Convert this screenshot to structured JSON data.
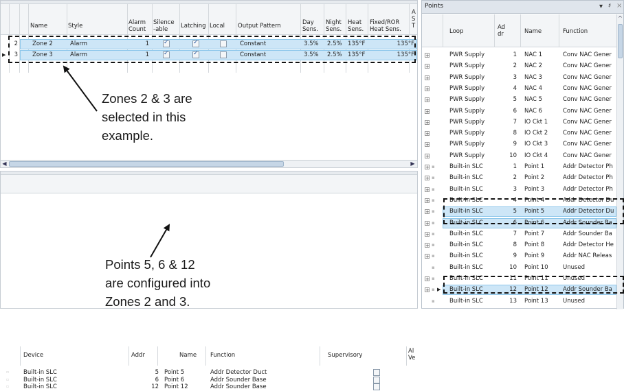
{
  "zones_table": {
    "headers": [
      [
        "Name"
      ],
      [
        "Style"
      ],
      [
        "Alarm",
        "Count"
      ],
      [
        "Silence",
        "-able"
      ],
      [
        "Latching"
      ],
      [
        "Local"
      ],
      [
        "Output Pattern"
      ],
      [
        "Day",
        "Sens."
      ],
      [
        "Night",
        "Sens."
      ],
      [
        "Heat",
        "Sens."
      ],
      [
        "Fixed/ROR",
        "Heat Sens."
      ],
      [
        "A",
        "S",
        "T"
      ]
    ],
    "rows": [
      {
        "num": "2",
        "name": "Zone 2",
        "style": "Alarm",
        "alarm_count": "1",
        "silenceable": true,
        "latching": true,
        "local": false,
        "output_pattern": "Constant",
        "day": "3.5%",
        "night": "2.5%",
        "heat": "135°F",
        "fixed_ror": "135°F"
      },
      {
        "num": "3",
        "name": "Zone 3",
        "style": "Alarm",
        "alarm_count": "1",
        "silenceable": true,
        "latching": true,
        "local": false,
        "output_pattern": "Constant",
        "day": "3.5%",
        "night": "2.5%",
        "heat": "135°F",
        "fixed_ror": "135°F"
      }
    ]
  },
  "zone_points_table": {
    "headers": [
      "Device",
      "Addr",
      "Name",
      "Function",
      "Supervisory",
      "Al",
      "Ve"
    ],
    "rows": [
      {
        "device": "Built-in SLC",
        "addr": "5",
        "name": "Point 5",
        "function": "Addr Detector Duct",
        "supervisory": false
      },
      {
        "device": "Built-in SLC",
        "addr": "6",
        "name": "Point 6",
        "function": "Addr Sounder Base",
        "supervisory": false
      },
      {
        "device": "Built-in SLC",
        "addr": "12",
        "name": "Point 12",
        "function": "Addr Sounder Base",
        "supervisory": false
      }
    ]
  },
  "points_panel": {
    "title": "Points",
    "controls": {
      "dropdown": "▾",
      "pin": "♯",
      "close": "×"
    },
    "headers": [
      "Loop",
      "Ad",
      "dr",
      "Name",
      "Function"
    ],
    "rows": [
      {
        "loop": "PWR Supply",
        "addr": "1",
        "name": "NAC 1",
        "function": "Conv NAC Gener"
      },
      {
        "loop": "PWR Supply",
        "addr": "2",
        "name": "NAC 2",
        "function": "Conv NAC Gener"
      },
      {
        "loop": "PWR Supply",
        "addr": "3",
        "name": "NAC 3",
        "function": "Conv NAC Gener"
      },
      {
        "loop": "PWR Supply",
        "addr": "4",
        "name": "NAC 4",
        "function": "Conv NAC Gener"
      },
      {
        "loop": "PWR Supply",
        "addr": "5",
        "name": "NAC 5",
        "function": "Conv NAC Gener"
      },
      {
        "loop": "PWR Supply",
        "addr": "6",
        "name": "NAC 6",
        "function": "Conv NAC Gener"
      },
      {
        "loop": "PWR Supply",
        "addr": "7",
        "name": "IO Ckt 1",
        "function": "Conv NAC Gener"
      },
      {
        "loop": "PWR Supply",
        "addr": "8",
        "name": "IO Ckt 2",
        "function": "Conv NAC Gener"
      },
      {
        "loop": "PWR Supply",
        "addr": "9",
        "name": "IO Ckt 3",
        "function": "Conv NAC Gener"
      },
      {
        "loop": "PWR Supply",
        "addr": "10",
        "name": "IO Ckt 4",
        "function": "Conv NAC Gener"
      },
      {
        "loop": "Built-in SLC",
        "addr": "1",
        "name": "Point 1",
        "function": "Addr Detector Ph"
      },
      {
        "loop": "Built-in SLC",
        "addr": "2",
        "name": "Point 2",
        "function": "Addr Detector Ph"
      },
      {
        "loop": "Built-in SLC",
        "addr": "3",
        "name": "Point 3",
        "function": "Addr Detector Ph"
      },
      {
        "loop": "Built-in SLC",
        "addr": "4",
        "name": "Point 4",
        "function": "Addr Detector Du"
      },
      {
        "loop": "Built-in SLC",
        "addr": "5",
        "name": "Point 5",
        "function": "Addr Detector Du"
      },
      {
        "loop": "Built-in SLC",
        "addr": "6",
        "name": "Point 6",
        "function": "Addr Sounder Ba"
      },
      {
        "loop": "Built-in SLC",
        "addr": "7",
        "name": "Point 7",
        "function": "Addr Sounder Ba"
      },
      {
        "loop": "Built-in SLC",
        "addr": "8",
        "name": "Point 8",
        "function": "Addr Detector He"
      },
      {
        "loop": "Built-in SLC",
        "addr": "9",
        "name": "Point 9",
        "function": "Addr NAC Releas"
      },
      {
        "loop": "Built-in SLC",
        "addr": "10",
        "name": "Point 10",
        "function": "Unused"
      },
      {
        "loop": "Built-in SLC",
        "addr": "11",
        "name": "Point 11",
        "function": "Unused"
      },
      {
        "loop": "Built-in SLC",
        "addr": "12",
        "name": "Point 12",
        "function": "Addr Sounder Ba"
      },
      {
        "loop": "Built-in SLC",
        "addr": "13",
        "name": "Point 13",
        "function": "Unused"
      }
    ]
  },
  "annotations": {
    "zones_note": [
      "Zones 2 & 3 are",
      "selected in this",
      "example."
    ],
    "points_note": [
      "Points 5, 6 & 12",
      "are configured into",
      "Zones 2 and 3."
    ]
  },
  "colors": {
    "selection": "#cde6f7",
    "selection_border": "#8cc6ea",
    "header_bg": "#f3f5f7",
    "panel_title_bg": "#dfe5ec"
  }
}
